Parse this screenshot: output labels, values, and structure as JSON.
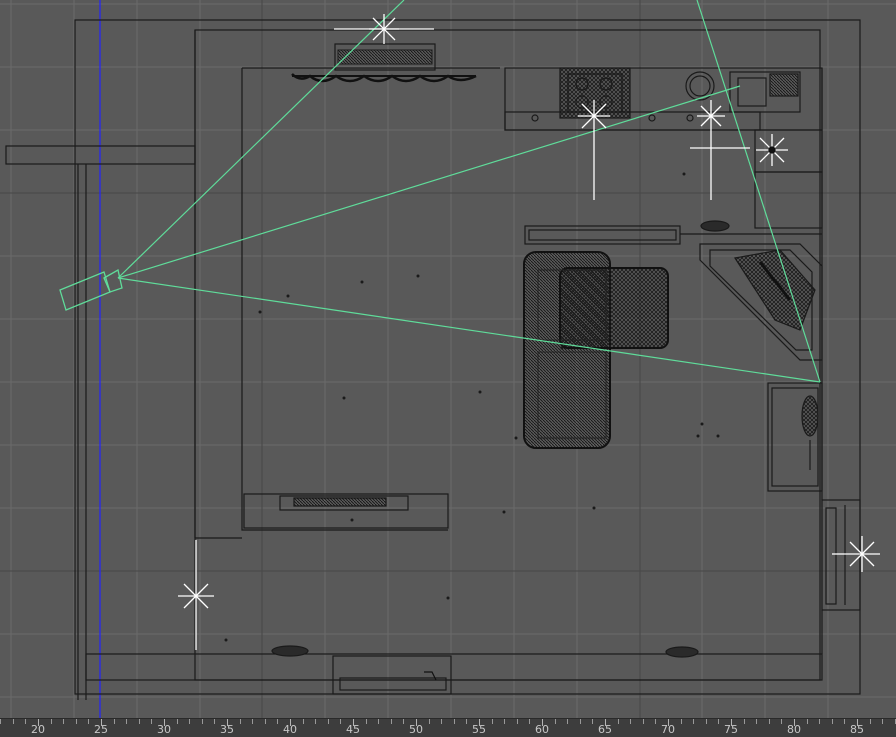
{
  "app": "3D viewport - top view floor plan",
  "colors": {
    "background": "#595959",
    "grid": "#6b6b6b",
    "lines": "#1a1a1a",
    "camera": "#5fdc9a",
    "lights": "#ffffff",
    "axis": "#2323ff"
  },
  "ruler": {
    "labels": [
      "20",
      "25",
      "30",
      "35",
      "40",
      "45",
      "50",
      "55",
      "60",
      "65",
      "70",
      "75",
      "80",
      "85"
    ]
  },
  "objects": {
    "camera": "camera-icon",
    "lights": [
      "light-1",
      "light-2",
      "light-3",
      "light-4",
      "light-5",
      "light-6"
    ]
  }
}
